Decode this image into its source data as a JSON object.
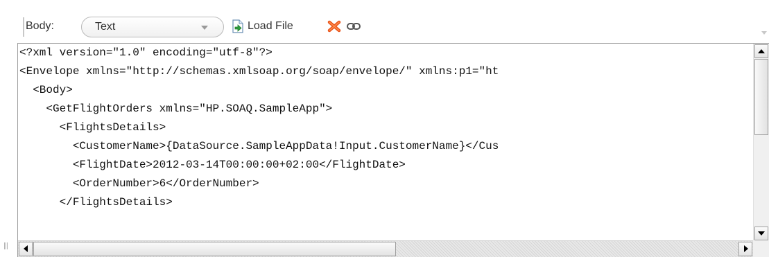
{
  "toolbar": {
    "body_label": "Body:",
    "body_type": {
      "selected": "Text"
    },
    "load_file_label": "Load File",
    "icons": {
      "load_file": "load-file-icon",
      "delete": "delete-icon",
      "link": "link-icon"
    }
  },
  "editor": {
    "lines": [
      "<?xml version=\"1.0\" encoding=\"utf-8\"?>",
      "<Envelope xmlns=\"http://schemas.xmlsoap.org/soap/envelope/\" xmlns:p1=\"ht",
      "  <Body>",
      "    <GetFlightOrders xmlns=\"HP.SOAQ.SampleApp\">",
      "      <FlightsDetails>",
      "        <CustomerName>{DataSource.SampleAppData!Input.CustomerName}</Cus",
      "        <FlightDate>2012-03-14T00:00:00+02:00</FlightDate>",
      "        <OrderNumber>6</OrderNumber>",
      "      </FlightsDetails>"
    ]
  },
  "colors": {
    "delete_icon": "#e8541b",
    "load_file_icon": "#2e9e3e",
    "text": "#111111"
  }
}
